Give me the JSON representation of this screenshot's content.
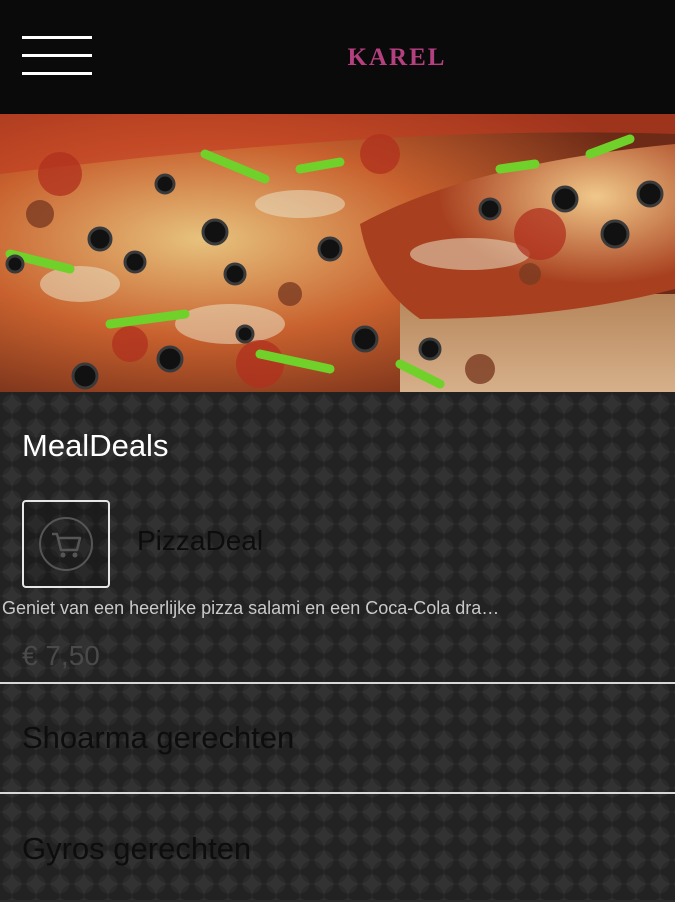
{
  "header": {
    "menu_icon": "hamburger-menu-icon",
    "brand": "KAREL",
    "brand_color": "#b5407f"
  },
  "hero": {
    "image": "pizza-photo"
  },
  "section": {
    "title": "MealDeals"
  },
  "deal": {
    "icon": "shopping-cart-icon",
    "title": "PizzaDeal",
    "description": "Geniet van een heerlijke pizza salami en een Coca-Cola dra…",
    "price": "€ 7,50"
  },
  "categories": [
    {
      "label": "Shoarma gerechten"
    },
    {
      "label": "Gyros gerechten"
    }
  ]
}
